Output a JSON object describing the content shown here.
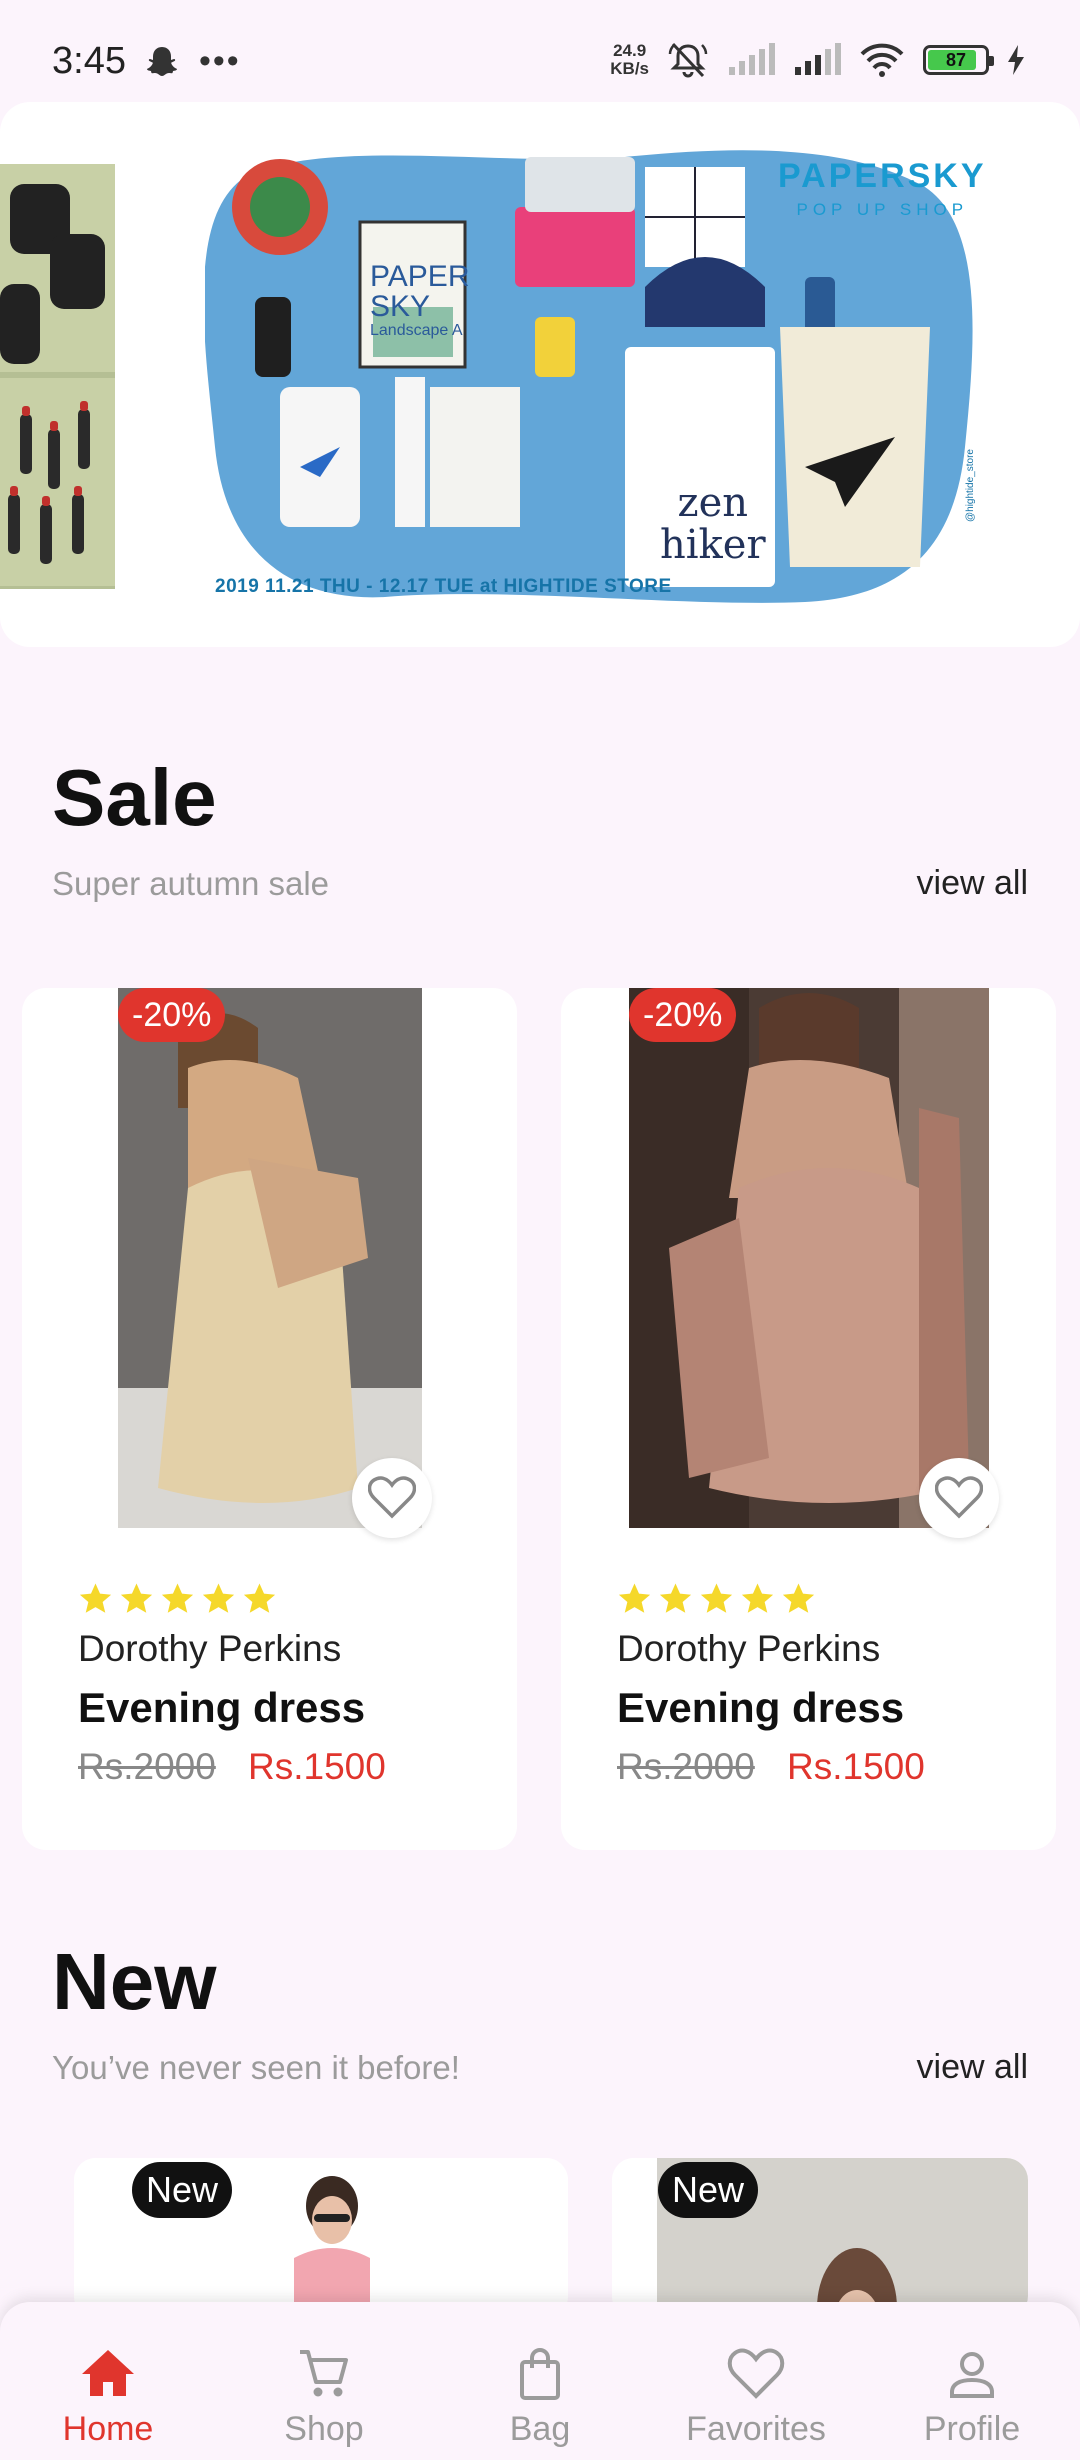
{
  "status_bar": {
    "time": "3:45",
    "overflow": "•••",
    "net_speed_value": "24.9",
    "net_speed_unit": "KB/s",
    "battery_level": "87",
    "icons": [
      "snapchat-icon",
      "bell-muted-icon",
      "signal-icon",
      "wifi-icon",
      "battery-icon",
      "charging-icon"
    ]
  },
  "banner": {
    "brand": "PAPERSKY",
    "subtitle": "POP UP SHOP",
    "date": "2019 11.21 THU - 12.17 TUE   at HIGHTIDE STORE",
    "book_title": "PAPER SKY",
    "book_sub": "Landscape A",
    "shirt_text_1": "zen",
    "shirt_text_2": "hiker",
    "side_text": "@hightide_store"
  },
  "sale": {
    "title": "Sale",
    "subtitle": "Super autumn sale",
    "view_all": "view all",
    "products": [
      {
        "discount": "-20%",
        "rating": 5,
        "brand": "Dorothy Perkins",
        "name": "Evening dress",
        "old_price": "Rs.2000",
        "price": "Rs.1500"
      },
      {
        "discount": "-20%",
        "rating": 5,
        "brand": "Dorothy Perkins",
        "name": "Evening dress",
        "old_price": "Rs.2000",
        "price": "Rs.1500"
      }
    ]
  },
  "new": {
    "title": "New",
    "subtitle": "You’ve never seen it before!",
    "view_all": "view all",
    "products": [
      {
        "badge": "New"
      },
      {
        "badge": "New"
      }
    ]
  },
  "bottom_nav": [
    {
      "label": "Home",
      "icon": "home-icon",
      "active": true
    },
    {
      "label": "Shop",
      "icon": "cart-icon",
      "active": false
    },
    {
      "label": "Bag",
      "icon": "bag-icon",
      "active": false
    },
    {
      "label": "Favorites",
      "icon": "heart-icon",
      "active": false
    },
    {
      "label": "Profile",
      "icon": "profile-icon",
      "active": false
    }
  ],
  "colors": {
    "accent": "#e0352d",
    "background": "#fcf4fc",
    "star": "#f5d82a"
  }
}
